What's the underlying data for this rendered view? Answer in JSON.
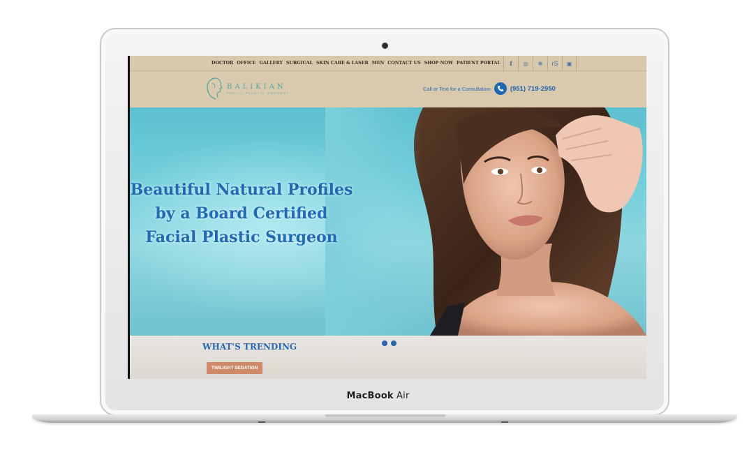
{
  "device": {
    "brand_bold": "MacBook",
    "brand_light": " Air"
  },
  "nav": {
    "links": [
      "DOCTOR",
      "OFFICE",
      "GALLERY",
      "SURGICAL",
      "SKIN CARE & LASER",
      "MEN",
      "CONTACT US",
      "SHOP NOW",
      "PATIENT PORTAL"
    ],
    "social": [
      "facebook-icon",
      "instagram-icon",
      "yelp-icon",
      "realself-icon",
      "youtube-icon"
    ],
    "social_glyphs": [
      "f",
      "◎",
      "✻",
      "rS",
      "▣"
    ]
  },
  "header": {
    "logo_name": "BALIKIAN",
    "logo_tagline": "FACIAL PLASTIC SURGERY",
    "call_text": "Call or Text for a Consultation",
    "phone": "(951) 719-2950"
  },
  "hero": {
    "line1": "Beautiful Natural Profiles",
    "line2": "by a Board Certified",
    "line3": "Facial Plastic Surgeon"
  },
  "trending": {
    "title": "WHAT'S TRENDING",
    "button": "TWILIGHT SEDATION"
  },
  "colors": {
    "accent_blue": "#1f69b5",
    "nav_bg": "#d8c9ac",
    "button": "#cf8a68",
    "teal": "#4fa6a3"
  }
}
